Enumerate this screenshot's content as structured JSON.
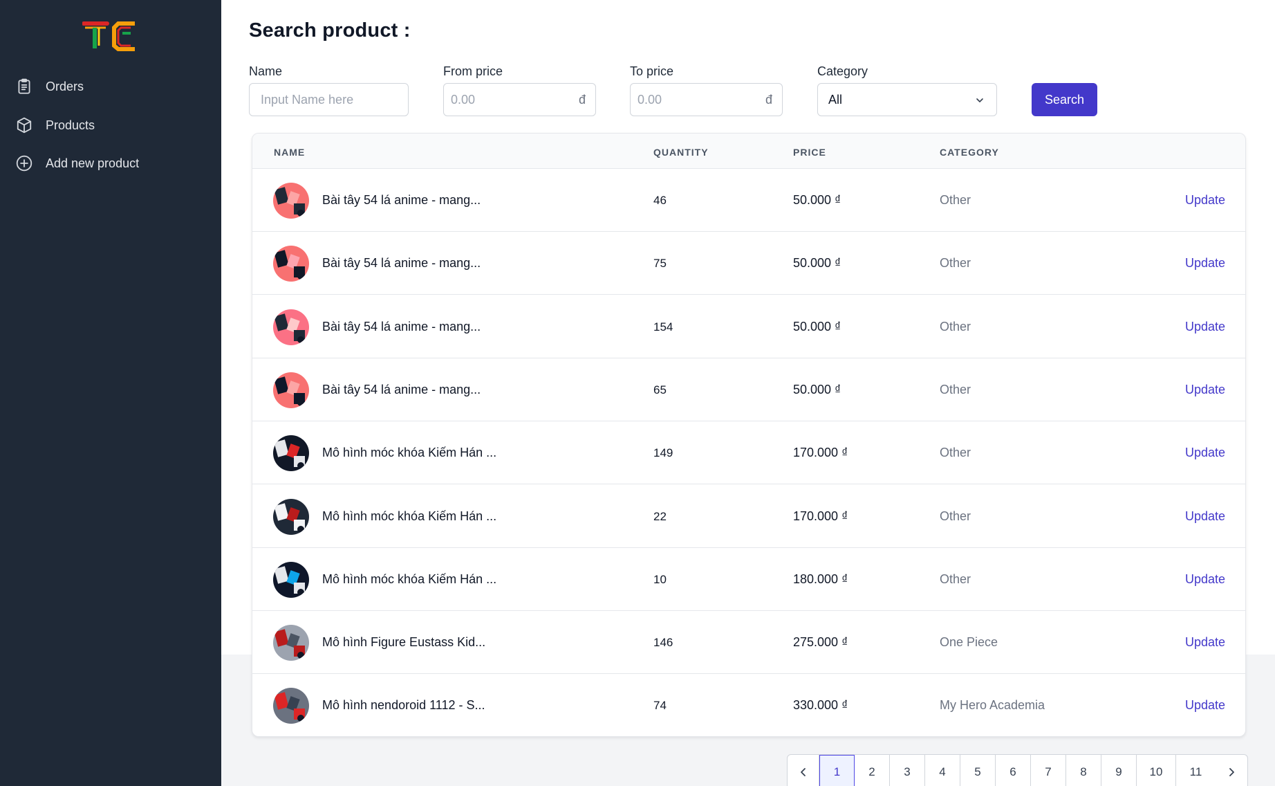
{
  "sidebar": {
    "logo_text": "TC",
    "items": [
      {
        "label": "Orders",
        "icon": "clipboard-icon"
      },
      {
        "label": "Products",
        "icon": "cube-icon"
      },
      {
        "label": "Add new product",
        "icon": "plus-circle-icon"
      }
    ]
  },
  "search": {
    "title": "Search product :",
    "name_label": "Name",
    "name_placeholder": "Input Name here",
    "from_label": "From price",
    "from_placeholder": "0.00",
    "to_label": "To price",
    "to_placeholder": "0.00",
    "currency_suffix": "đ",
    "category_label": "Category",
    "category_value": "All",
    "button_label": "Search"
  },
  "table": {
    "headers": {
      "name": "NAME",
      "quantity": "QUANTITY",
      "price": "PRICE",
      "category": "CATEGORY"
    },
    "action_label": "Update",
    "rows": [
      {
        "name": "Bài tây 54 lá anime - mang...",
        "quantity": "46",
        "price": "50.000 ₫",
        "category": "Other"
      },
      {
        "name": "Bài tây 54 lá anime - mang...",
        "quantity": "75",
        "price": "50.000 ₫",
        "category": "Other"
      },
      {
        "name": "Bài tây 54 lá anime - mang...",
        "quantity": "154",
        "price": "50.000 ₫",
        "category": "Other"
      },
      {
        "name": "Bài tây 54 lá anime - mang...",
        "quantity": "65",
        "price": "50.000 ₫",
        "category": "Other"
      },
      {
        "name": "Mô hình móc khóa Kiếm Hán ...",
        "quantity": "149",
        "price": "170.000 ₫",
        "category": "Other"
      },
      {
        "name": "Mô hình móc khóa Kiếm Hán ...",
        "quantity": "22",
        "price": "170.000 ₫",
        "category": "Other"
      },
      {
        "name": "Mô hình móc khóa Kiếm Hán ...",
        "quantity": "10",
        "price": "180.000 ₫",
        "category": "Other"
      },
      {
        "name": "Mô hình Figure Eustass Kid...",
        "quantity": "146",
        "price": "275.000 ₫",
        "category": "One Piece"
      },
      {
        "name": "Mô hình nendoroid 1112 - S...",
        "quantity": "74",
        "price": "330.000 ₫",
        "category": "My Hero Academia"
      }
    ]
  },
  "pagination": {
    "pages": [
      "1",
      "2",
      "3",
      "4",
      "5",
      "6",
      "7",
      "8",
      "9",
      "10",
      "11"
    ],
    "current": "1"
  },
  "colors": {
    "sidebar_bg": "#1f2937",
    "accent": "#4338ca",
    "muted_text": "#6b7280"
  }
}
